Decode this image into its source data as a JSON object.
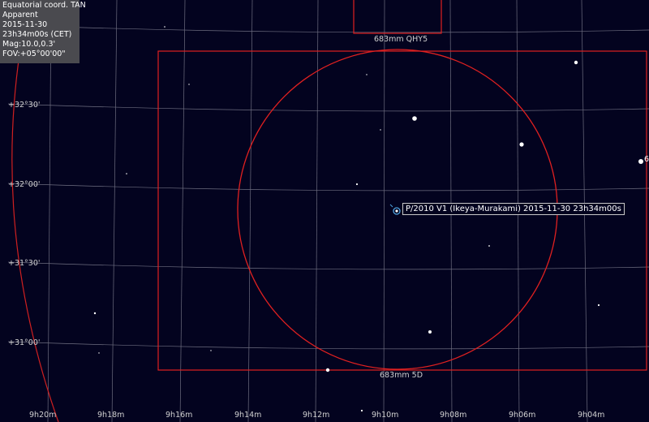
{
  "info": {
    "projection": "Equatorial coord. TAN",
    "mode": "Apparent",
    "date": "2015-11-30",
    "time": "23h34m00s (CET)",
    "mag": "Mag:10.0,0.3'",
    "fov": "FOV:+05°00'00\""
  },
  "dec_labels": [
    "+32°30'",
    "+32°00'",
    "+31°30'",
    "+31°00'"
  ],
  "ra_labels": [
    "9h20m",
    "9h18m",
    "9h16m",
    "9h14m",
    "9h12m",
    "9h10m",
    "9h08m",
    "9h06m",
    "9h04m"
  ],
  "frames": {
    "top_label": "683mm QHY5",
    "bottom_label": "683mm 5D"
  },
  "target": {
    "label": "P/2010 V1 (Ikeya-Murakami) 2015-11-30 23h34m00s"
  },
  "edge_label": "6",
  "colors": {
    "background": "#03031f",
    "grid": "#7a7a8a",
    "eyepiece": "#e02020",
    "target": "#4fa3e0"
  }
}
